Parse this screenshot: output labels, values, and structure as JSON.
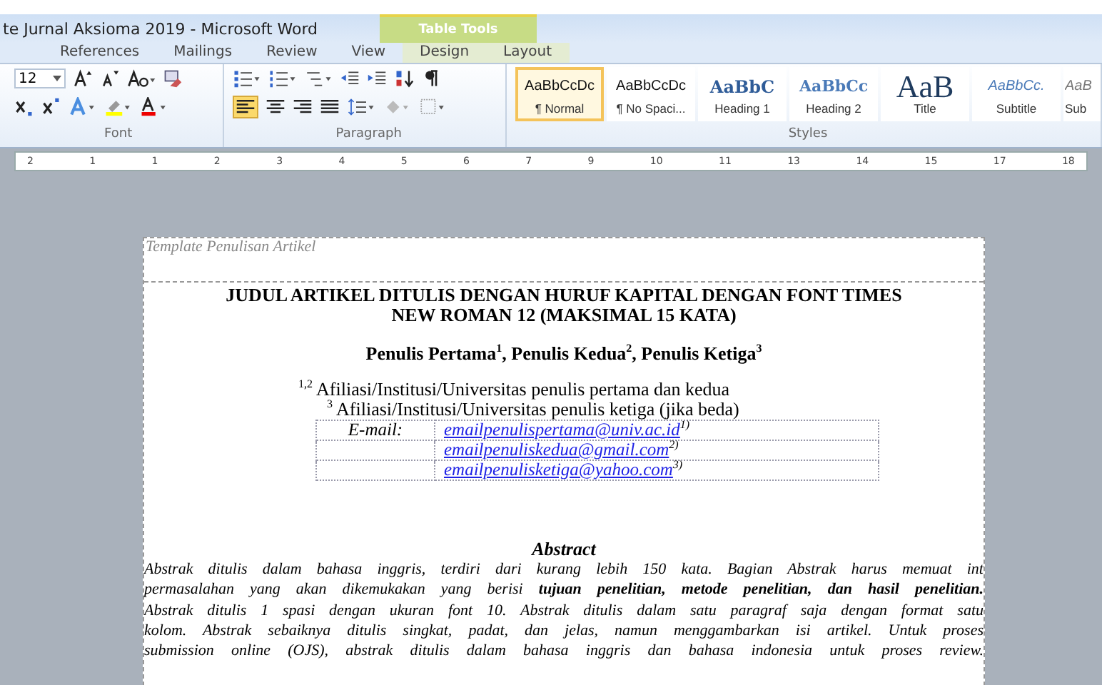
{
  "window": {
    "title": "te Jurnal Aksioma 2019  -  Microsoft Word",
    "context_tab": "Table Tools"
  },
  "tabs": [
    {
      "label": "References",
      "selected": false
    },
    {
      "label": "Mailings",
      "selected": false
    },
    {
      "label": "Review",
      "selected": false
    },
    {
      "label": "View",
      "selected": false
    },
    {
      "label": "Design",
      "selected": false,
      "kind": "context"
    },
    {
      "label": "Layout",
      "selected": false,
      "kind": "context"
    }
  ],
  "ribbon": {
    "font_size": "12",
    "groups": [
      "Font",
      "Paragraph",
      "Styles"
    ],
    "styles": [
      {
        "sample": "AaBbCcDc",
        "label": "¶ Normal",
        "kind": "normal",
        "selected": true
      },
      {
        "sample": "AaBbCcDc",
        "label": "¶ No Spaci...",
        "kind": "normal",
        "selected": false
      },
      {
        "sample": "AaBbC",
        "label": "Heading 1",
        "kind": "heading1",
        "selected": false
      },
      {
        "sample": "AaBbCc",
        "label": "Heading 2",
        "kind": "heading2",
        "selected": false
      },
      {
        "sample": "AaB",
        "label": "Title",
        "kind": "title",
        "selected": false
      },
      {
        "sample": "AaBbCc.",
        "label": "Subtitle",
        "kind": "subtitle",
        "selected": false
      },
      {
        "sample": "AaB",
        "label": "Sub",
        "kind": "subtle",
        "selected": false
      }
    ]
  },
  "ruler": [
    "2",
    "1",
    "1",
    "2",
    "3",
    "4",
    "5",
    "6",
    "7",
    "9",
    "10",
    "11",
    "13",
    "14",
    "15",
    "17",
    "18"
  ],
  "document": {
    "header": "Template Penulisan Artikel",
    "title": [
      "JUDUL ARTIKEL DITULIS DENGAN HURUF KAPITAL DENGAN FONT TIMES",
      "NEW ROMAN 12 (MAKSIMAL 15 KATA)"
    ],
    "authors": "Penulis Pertama$^{1}$,  Penulis Kedua$^{2}$, Penulis Ketiga$^{3}$",
    "affiliations": [
      "$^{1,2}$ Afiliasi/Institusi/Universitas penulis pertama dan kedua",
      "$^{3}$ Afiliasi/Institusi/Universitas penulis ketiga (jika beda)"
    ],
    "email_label": "E-mail:",
    "emails": [
      {
        "address": "emailpenulispertama@univ.ac.id",
        "note": "1)"
      },
      {
        "address": "emailpenuliskedua@gmail.com",
        "note": "2)"
      },
      {
        "address": "emailpenulisketiga@yahoo.com",
        "note": "3)"
      }
    ],
    "abstract_heading": "Abstract",
    "abstract_lines": [
      "Abstrak ditulis dalam bahasa inggris, terdiri dari kurang lebih 150 kata. Bagian Abstrak harus memuat int",
      "permasalahan yang akan dikemukakan yang berisi **tujuan penelitian, metode penelitian, dan hasil penelitian.**",
      "Abstrak ditulis 1 spasi dengan ukuran font 10. Abstrak ditulis dalam satu paragraf saja dengan format satu",
      "kolom. Abstrak sebaiknya ditulis singkat, padat, dan jelas, namun menggambarkan isi artikel. Untuk proses",
      "submission online (OJS), abstrak ditulis dalam bahasa inggris dan bahasa indonesia untuk proses review."
    ]
  }
}
